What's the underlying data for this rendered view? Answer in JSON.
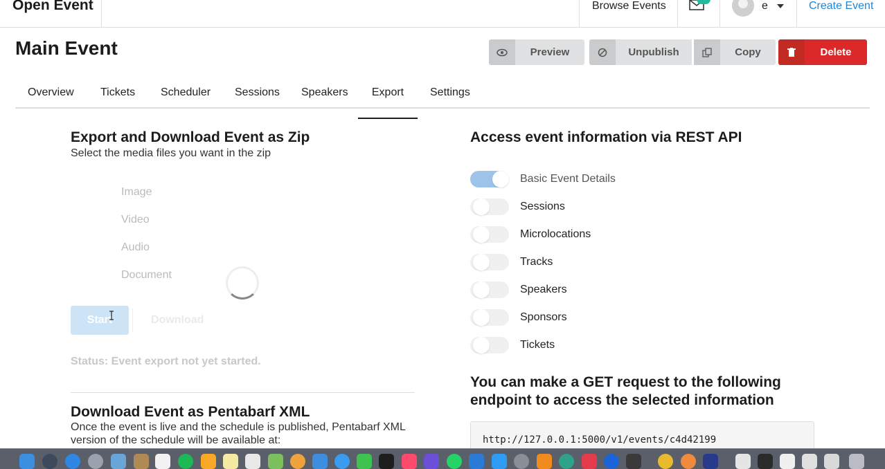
{
  "topnav": {
    "brand": "Open Event",
    "browse_events": "Browse Events",
    "user": "e",
    "create_event": "Create Event"
  },
  "header": {
    "title": "Main Event",
    "preview": "Preview",
    "unpublish": "Unpublish",
    "copy": "Copy",
    "delete": "Delete"
  },
  "tabs": [
    "Overview",
    "Tickets",
    "Scheduler",
    "Sessions",
    "Speakers",
    "Export",
    "Settings"
  ],
  "active_tab": "Export",
  "zip": {
    "title": "Export and Download Event as Zip",
    "subtitle": "Select the media files you want in the zip",
    "options": [
      "Image",
      "Video",
      "Audio",
      "Document"
    ],
    "start": "Start",
    "download": "Download",
    "status": "Status: Event export not yet started."
  },
  "pentabarf": {
    "title": "Download Event as Pentabarf XML",
    "desc1": "Once the event is live and the schedule is published, Pentabarf XML",
    "desc2": "version of the schedule will be available at:"
  },
  "api": {
    "title": "Access event information via REST API",
    "toggles": [
      {
        "label": "Basic Event Details",
        "on": true
      },
      {
        "label": "Sessions",
        "on": false
      },
      {
        "label": "Microlocations",
        "on": false
      },
      {
        "label": "Tracks",
        "on": false
      },
      {
        "label": "Speakers",
        "on": false
      },
      {
        "label": "Sponsors",
        "on": false
      },
      {
        "label": "Tickets",
        "on": false
      }
    ],
    "get_title_1": "You can make a GET request to the following",
    "get_title_2": "endpoint to access the selected information",
    "endpoint": "http://127.0.0.1:5000/v1/events/c4d42199"
  },
  "colors": {
    "primary": "#2185d0",
    "danger": "#db2828",
    "toggle_on": "#9ec3e8"
  }
}
